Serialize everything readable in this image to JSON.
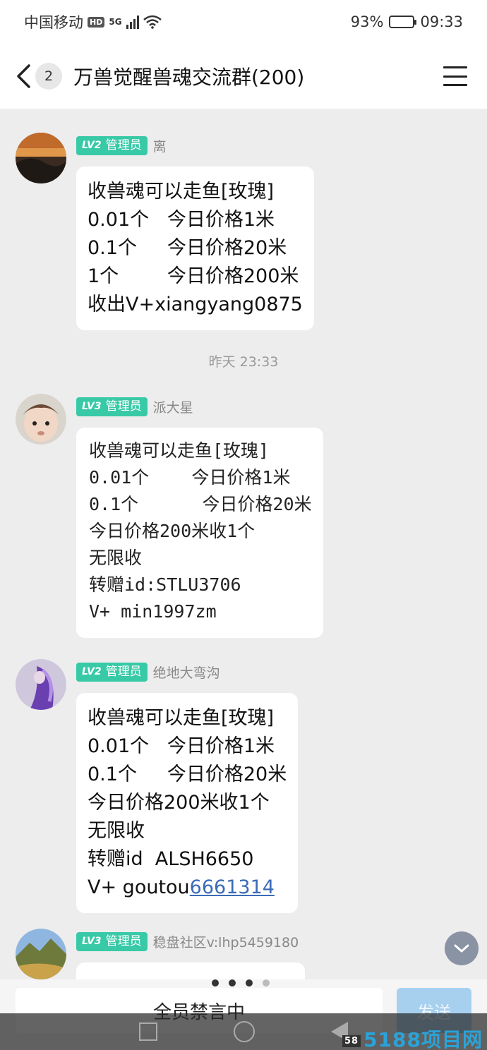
{
  "status_bar": {
    "carrier": "中国移动",
    "hd": "HD",
    "net": "5G",
    "battery": "93%",
    "battery_level": 0.93,
    "time": "09:33"
  },
  "header": {
    "back_count": "2",
    "title": "万兽觉醒兽魂交流群(200)"
  },
  "messages": [
    {
      "level": "LV2",
      "role": "管理员",
      "name": "离",
      "lines": [
        "收兽魂可以走鱼[玫瑰]",
        "0.01个   今日价格1米",
        "0.1个     今日价格20米",
        "1个        今日价格200米",
        "收出V+xiangyang0875"
      ]
    },
    {
      "level": "LV3",
      "role": "管理员",
      "name": "派大星",
      "lines": [
        "收兽魂可以走鱼[玫瑰]",
        "0.01个    今日价格1米",
        "0.1个      今日价格20米",
        "今日价格200米收1个",
        "无限收",
        "转赠id:STLU3706",
        "V+ min1997zm"
      ]
    },
    {
      "level": "LV2",
      "role": "管理员",
      "name": "绝地大弯沟",
      "lines": [
        "收兽魂可以走鱼[玫瑰]",
        "0.01个   今日价格1米",
        "0.1个     今日价格20米",
        "今日价格200米收1个",
        "无限收",
        "转赠id  ALSH6650"
      ],
      "last_line_prefix": "V+ goutou",
      "last_line_link": "6661314"
    },
    {
      "level": "LV3",
      "role": "管理员",
      "name": "稳盘社区v:lhp5459180"
    }
  ],
  "timestamp": "昨天 23:33",
  "input": {
    "muted_text": "全员禁言中",
    "send_label": "发送"
  },
  "watermark": {
    "small": "58",
    "text": "5188项目网"
  },
  "colors": {
    "tag": "#38c9a7",
    "link": "#3b6bb6",
    "send": "#a7d0ef"
  }
}
